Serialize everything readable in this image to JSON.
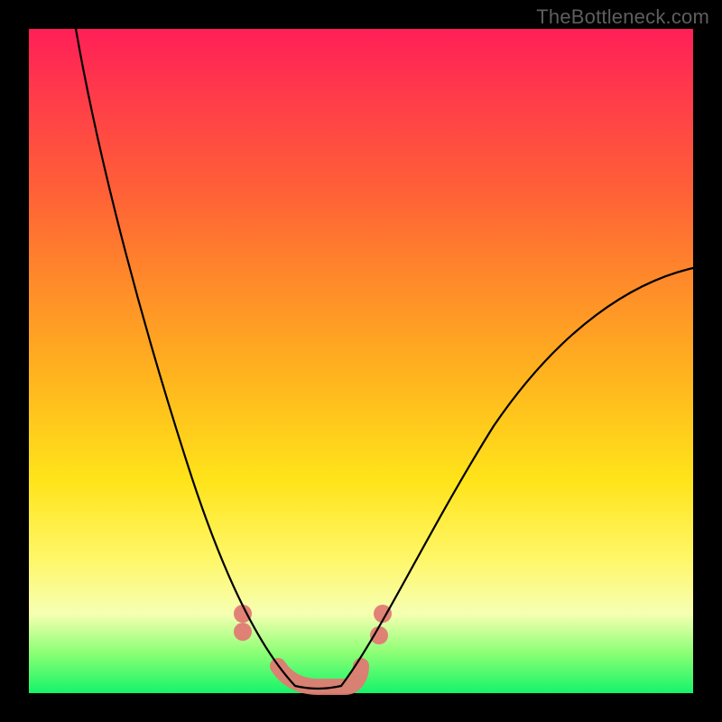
{
  "watermark": "TheBottleneck.com",
  "colors": {
    "background": "#000000",
    "curve_stroke": "#000000",
    "coral": "#e07a73",
    "gradient_stops": [
      "#ff1f57",
      "#ff3b4a",
      "#ff6236",
      "#ff8a2a",
      "#ffb31e",
      "#ffe41a",
      "#fff76a",
      "#f6ffb2",
      "#8bff75",
      "#15f46a"
    ]
  },
  "chart_data": {
    "type": "line",
    "title": "",
    "xlabel": "",
    "ylabel": "",
    "xlim": [
      0,
      100
    ],
    "ylim": [
      0,
      100
    ],
    "series": [
      {
        "name": "left-curve",
        "x": [
          7,
          10,
          15,
          20,
          25,
          30,
          35,
          37.5,
          40
        ],
        "values": [
          100,
          84,
          62,
          44,
          29,
          17,
          8,
          4,
          1
        ]
      },
      {
        "name": "right-curve",
        "x": [
          47,
          50,
          55,
          60,
          70,
          80,
          90,
          100
        ],
        "values": [
          1,
          4,
          11,
          19,
          34,
          46,
          56,
          64
        ]
      },
      {
        "name": "valley-floor",
        "x": [
          40,
          43.5,
          47
        ],
        "values": [
          1,
          0,
          1
        ]
      }
    ],
    "annotations": [
      {
        "name": "coral-valley-band",
        "x_range": [
          37.5,
          50
        ],
        "y_range": [
          0,
          4
        ]
      },
      {
        "name": "coral-dot-left",
        "x": 32,
        "y": 12
      },
      {
        "name": "coral-dot-right",
        "x": 53,
        "y": 8
      }
    ]
  }
}
